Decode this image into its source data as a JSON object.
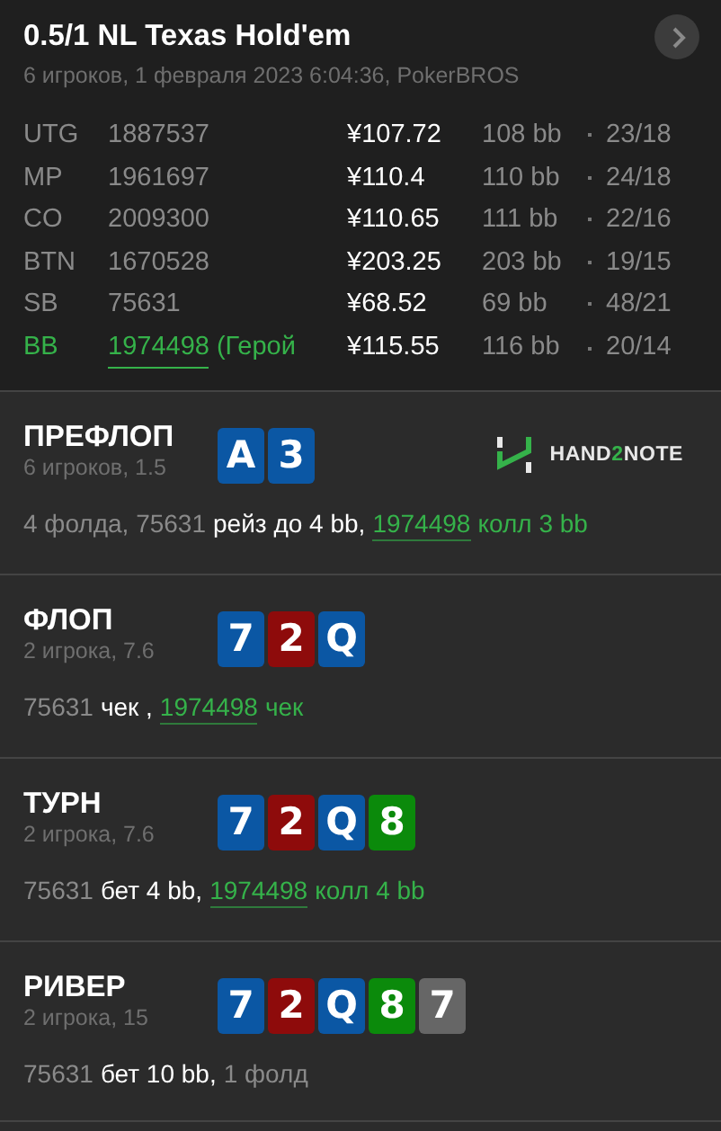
{
  "header": {
    "title": "0.5/1 NL Texas Hold'em",
    "subtitle": "6 игроков, 1 февраля 2023 6:04:36, PokerBROS"
  },
  "players": [
    {
      "position": "UTG",
      "name": "1887537",
      "stack": "¥107.72",
      "bb": "108 bb",
      "stats": "23/18",
      "hero": false
    },
    {
      "position": "MP",
      "name": "1961697",
      "stack": "¥110.4",
      "bb": "110 bb",
      "stats": "24/18",
      "hero": false
    },
    {
      "position": "CO",
      "name": "2009300",
      "stack": "¥110.65",
      "bb": "111 bb",
      "stats": "22/16",
      "hero": false
    },
    {
      "position": "BTN",
      "name": "1670528",
      "stack": "¥203.25",
      "bb": "203 bb",
      "stats": "19/15",
      "hero": false
    },
    {
      "position": "SB",
      "name": "75631",
      "stack": "¥68.52",
      "bb": "69 bb",
      "stats": "48/21",
      "hero": false
    },
    {
      "position": "BB",
      "name": "1974498",
      "suffix": "(Герой",
      "stack": "¥115.55",
      "bb": "116 bb",
      "stats": "20/14",
      "hero": true
    }
  ],
  "logo": {
    "before": "HAND",
    "accent": "2",
    "after": "NOTE"
  },
  "streets": [
    {
      "title": "ПРЕФЛОП",
      "subtitle": "6 игроков, 1.5",
      "cards": [
        {
          "rank": "A",
          "color": "#0b57a4"
        },
        {
          "rank": "3",
          "color": "#0b57a4"
        }
      ],
      "actions": [
        {
          "kind": "player",
          "text": "4 фолда, 75631"
        },
        {
          "kind": "action",
          "text": "рейз до 4 bb,"
        },
        {
          "kind": "hero",
          "text": "1974498"
        },
        {
          "kind": "hero-action",
          "text": "колл 3 bb"
        }
      ]
    },
    {
      "title": "ФЛОП",
      "subtitle": "2 игрока, 7.6",
      "cards": [
        {
          "rank": "7",
          "color": "#0b57a4"
        },
        {
          "rank": "2",
          "color": "#8e0b0b"
        },
        {
          "rank": "Q",
          "color": "#0b57a4"
        }
      ],
      "actions": [
        {
          "kind": "player",
          "text": "75631"
        },
        {
          "kind": "action",
          "text": "чек ,"
        },
        {
          "kind": "hero",
          "text": "1974498"
        },
        {
          "kind": "hero-action",
          "text": "чек"
        }
      ]
    },
    {
      "title": "ТУРН",
      "subtitle": "2 игрока, 7.6",
      "cards": [
        {
          "rank": "7",
          "color": "#0b57a4"
        },
        {
          "rank": "2",
          "color": "#8e0b0b"
        },
        {
          "rank": "Q",
          "color": "#0b57a4"
        },
        {
          "rank": "8",
          "color": "#0b8a0b"
        }
      ],
      "actions": [
        {
          "kind": "player",
          "text": "75631"
        },
        {
          "kind": "action",
          "text": "бет 4 bb,"
        },
        {
          "kind": "hero",
          "text": "1974498"
        },
        {
          "kind": "hero-action",
          "text": "колл 4 bb"
        }
      ]
    },
    {
      "title": "РИВЕР",
      "subtitle": "2 игрока, 15",
      "cards": [
        {
          "rank": "7",
          "color": "#0b57a4"
        },
        {
          "rank": "2",
          "color": "#8e0b0b"
        },
        {
          "rank": "Q",
          "color": "#0b57a4"
        },
        {
          "rank": "8",
          "color": "#0b8a0b"
        },
        {
          "rank": "7",
          "color": "#666666"
        }
      ],
      "actions": [
        {
          "kind": "player",
          "text": "75631"
        },
        {
          "kind": "action",
          "text": "бет 10 bb,"
        },
        {
          "kind": "player",
          "text": "1 фолд"
        }
      ]
    }
  ]
}
